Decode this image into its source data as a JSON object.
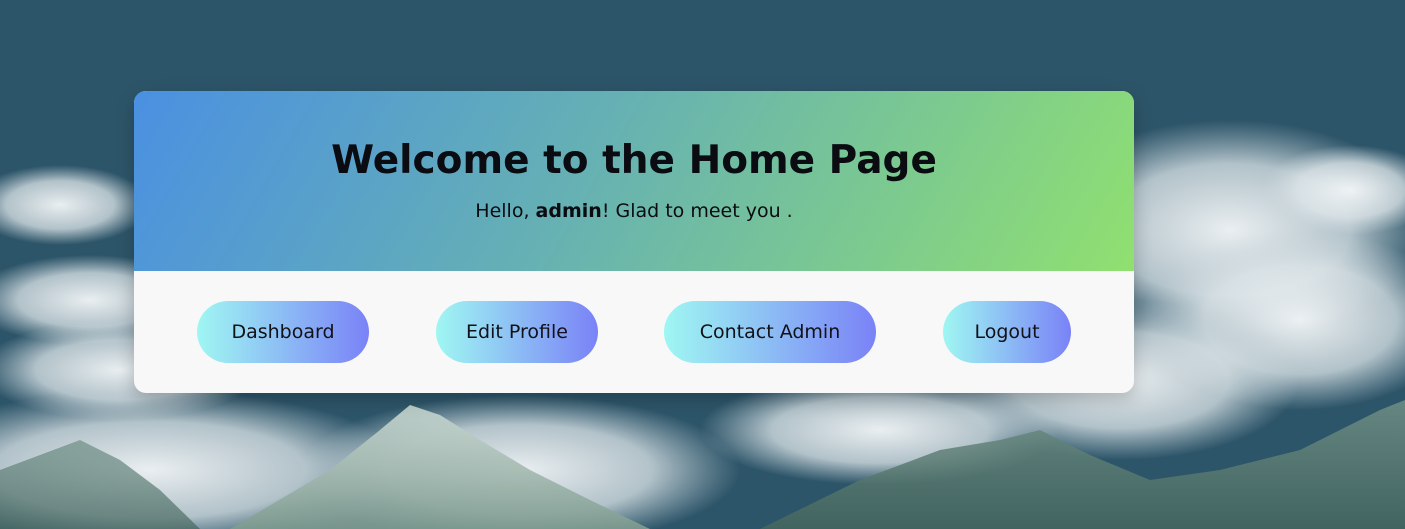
{
  "card": {
    "title": "Welcome to the Home Page",
    "greeting_prefix": "Hello, ",
    "username": "admin",
    "greeting_suffix": "! Glad to meet you ."
  },
  "actions": {
    "dashboard_label": "Dashboard",
    "edit_profile_label": "Edit Profile",
    "contact_admin_label": "Contact Admin",
    "logout_label": "Logout"
  },
  "colors": {
    "page_background": "#2d5569",
    "header_gradient_start": "#4a90e2",
    "header_gradient_end": "#90e070",
    "button_gradient_start": "#9ff7f2",
    "button_gradient_end": "#7a82f7"
  }
}
